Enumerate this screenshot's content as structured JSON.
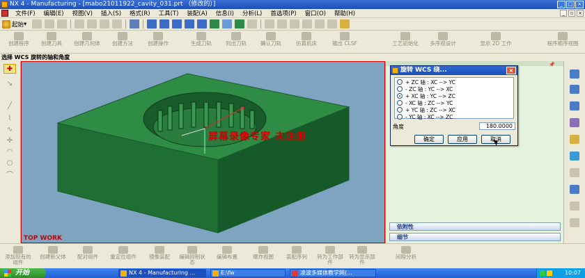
{
  "window": {
    "title": "NX 4 - Manufacturing - [mabo21011922_cavity_031.prt （修改的）]"
  },
  "menu": [
    "文件(F)",
    "编辑(E)",
    "视图(V)",
    "插入(S)",
    "格式(R)",
    "工具(T)",
    "装配(A)",
    "信息(I)",
    "分析(L)",
    "首选项(P)",
    "窗口(O)",
    "帮助(H)"
  ],
  "toolbar1": {
    "start_label": "起始"
  },
  "toolbar2": {
    "items": [
      "创建程序",
      "创建刀具",
      "创建几何体",
      "创建方法",
      "创建操作",
      "生成刀轨",
      "列出刀轨",
      "确认刀轨",
      "仿真机床",
      "输出 CLSF",
      "工艺初始化",
      "多序视设计",
      "显示 2D 工作",
      "程序顺序视图"
    ]
  },
  "cue_line": "选择 WCS 旋转的轴和角度",
  "viewport": {
    "label": "TOP WORK",
    "watermark": "屏幕录像专家 未注册"
  },
  "dialog": {
    "title": "旋转 WCS 绕...",
    "options": [
      {
        "label": "+ ZC 轴 : XC --> YC",
        "selected": false
      },
      {
        "label": "- ZC 轴 : YC --> XC",
        "selected": false
      },
      {
        "label": "+ XC 轴 : YC --> ZC",
        "selected": true
      },
      {
        "label": "- XC 轴 : ZC --> YC",
        "selected": false
      },
      {
        "label": "+ YC 轴 : ZC --> XC",
        "selected": false
      },
      {
        "label": "- YC 轴 : XC --> ZC",
        "selected": false
      }
    ],
    "angle_label": "角度",
    "angle_value": "180.0000",
    "ok_label": "确定",
    "apply_label": "应用",
    "cancel_label": "取消"
  },
  "resource_panel": {
    "sections": [
      "依附性",
      "细节"
    ]
  },
  "bottom_toolbar": {
    "items": [
      "添加现有的组件",
      "创建新父体",
      "配对组件",
      "重定位组件",
      "镜像装配",
      "编辑抑制状态",
      "编辑布置",
      "爆炸视图",
      "装配序列",
      "转为工作部件",
      "转为显示部件",
      "间隙分析"
    ]
  },
  "taskbar": {
    "start_label": "开始",
    "tasks": [
      "NX 4 - Manufacturing ...",
      "E:\\fw",
      "凌波多媒体教学网(..."
    ],
    "clock": "10:07"
  },
  "colors": {
    "part_top": "#2e8c45",
    "part_front": "#1f6e33",
    "part_side": "#175a29",
    "viewport_bg": "#7ea4c2"
  }
}
